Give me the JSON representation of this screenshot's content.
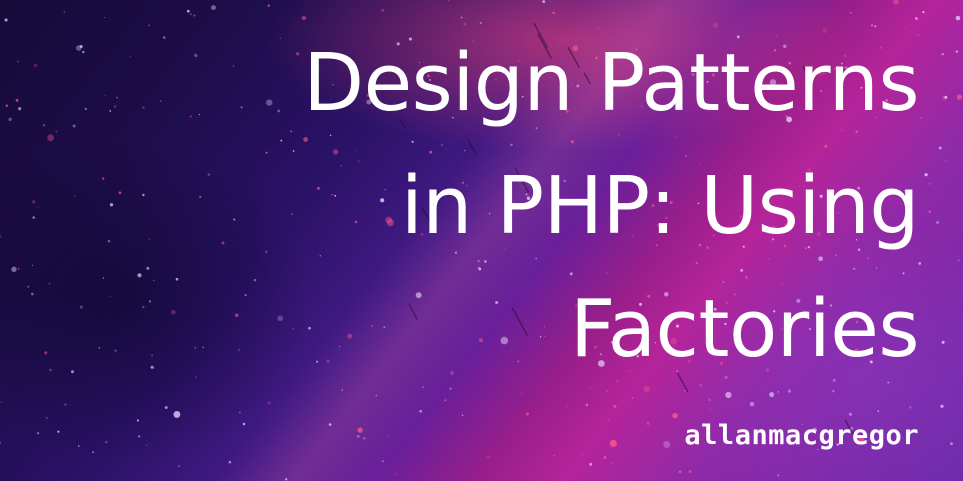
{
  "banner": {
    "title_lines": [
      "Design Patterns",
      "in PHP: Using",
      "Factories"
    ],
    "author": "allanmacgregor"
  },
  "colors": {
    "background_dark": "#1a0b3d",
    "background_mid": "#5a1f9a",
    "background_accent": "#b5249a",
    "speck_pink": "#ff5a8a",
    "text": "#ffffff"
  }
}
